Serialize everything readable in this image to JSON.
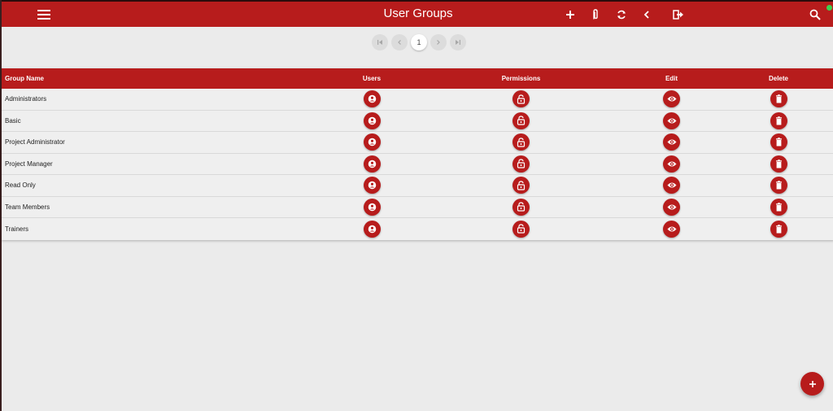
{
  "appbar": {
    "title": "User Groups",
    "icons": [
      "menu-icon",
      "add-icon",
      "attach-icon",
      "refresh-icon",
      "back-icon",
      "logout-icon",
      "search-icon"
    ],
    "status_color": "#3fd04f"
  },
  "pagination": {
    "current_page": "1",
    "icons": [
      "first-page-icon",
      "prev-page-icon",
      "next-page-icon",
      "last-page-icon"
    ]
  },
  "table": {
    "headers": {
      "group_name": "Group Name",
      "users": "Users",
      "permissions": "Permissions",
      "edit": "Edit",
      "delete": "Delete"
    },
    "rows": [
      {
        "name": "Administrators"
      },
      {
        "name": "Basic"
      },
      {
        "name": "Project Administrator"
      },
      {
        "name": "Project Manager"
      },
      {
        "name": "Read Only"
      },
      {
        "name": "Team Members"
      },
      {
        "name": "Trainers"
      }
    ],
    "row_icons": [
      "user-icon",
      "lock-icon",
      "eye-icon",
      "trash-icon"
    ]
  },
  "theme": {
    "primary": "#b71c1c",
    "background": "#ebebeb"
  }
}
